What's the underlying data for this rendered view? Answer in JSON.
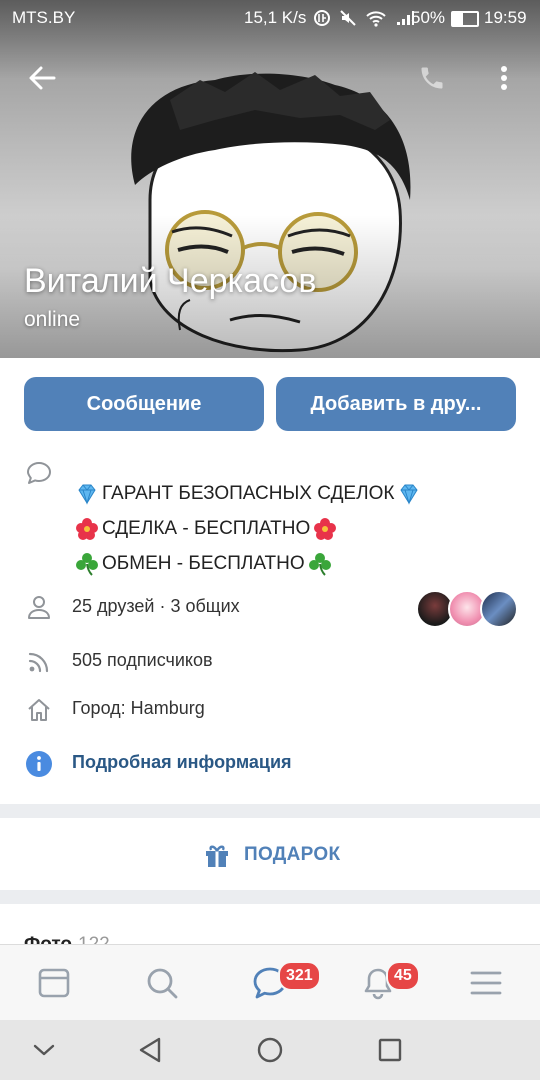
{
  "status_bar": {
    "carrier": "MTS.BY",
    "network_speed": "15,1 K/s",
    "battery_percent": "50%",
    "time": "19:59"
  },
  "profile": {
    "name": "Виталий Черкасов",
    "online_status": "online"
  },
  "actions": {
    "message_label": "Сообщение",
    "add_friend_label": "Добавить в дру..."
  },
  "status_text": {
    "line1": "ГАРАНТ БЕЗОПАСНЫХ СДЕЛОК",
    "line2": "СДЕЛКА - БЕСПЛАТНО",
    "line3": "ОБМЕН - БЕСПЛАТНО"
  },
  "info": {
    "friends": "25 друзей · 3 общих",
    "followers": "505 подписчиков",
    "city": "Город: Hamburg",
    "more_info": "Подробная информация"
  },
  "gift": {
    "label": "ПОДАРОК"
  },
  "photos": {
    "title": "Фото",
    "count": "122"
  },
  "tabbar": {
    "messages_badge": "321",
    "notifications_badge": "45"
  },
  "colors": {
    "accent": "#5181b8",
    "link": "#2a5885",
    "badge": "#e64646",
    "info_icon": "#4a8be0"
  },
  "icons": {
    "back": "arrow-left-icon",
    "call": "phone-icon",
    "more": "more-vertical-icon",
    "status": "speech-bubble-icon",
    "friends": "person-icon",
    "followers": "rss-icon",
    "city": "house-icon",
    "more_info": "info-icon",
    "gift": "gift-icon",
    "tabs": [
      "news-icon",
      "search-icon",
      "messages-icon",
      "bell-icon",
      "menu-icon"
    ],
    "system_nav": [
      "chevron-down-icon",
      "back-triangle-icon",
      "home-circle-icon",
      "recent-square-icon"
    ]
  }
}
